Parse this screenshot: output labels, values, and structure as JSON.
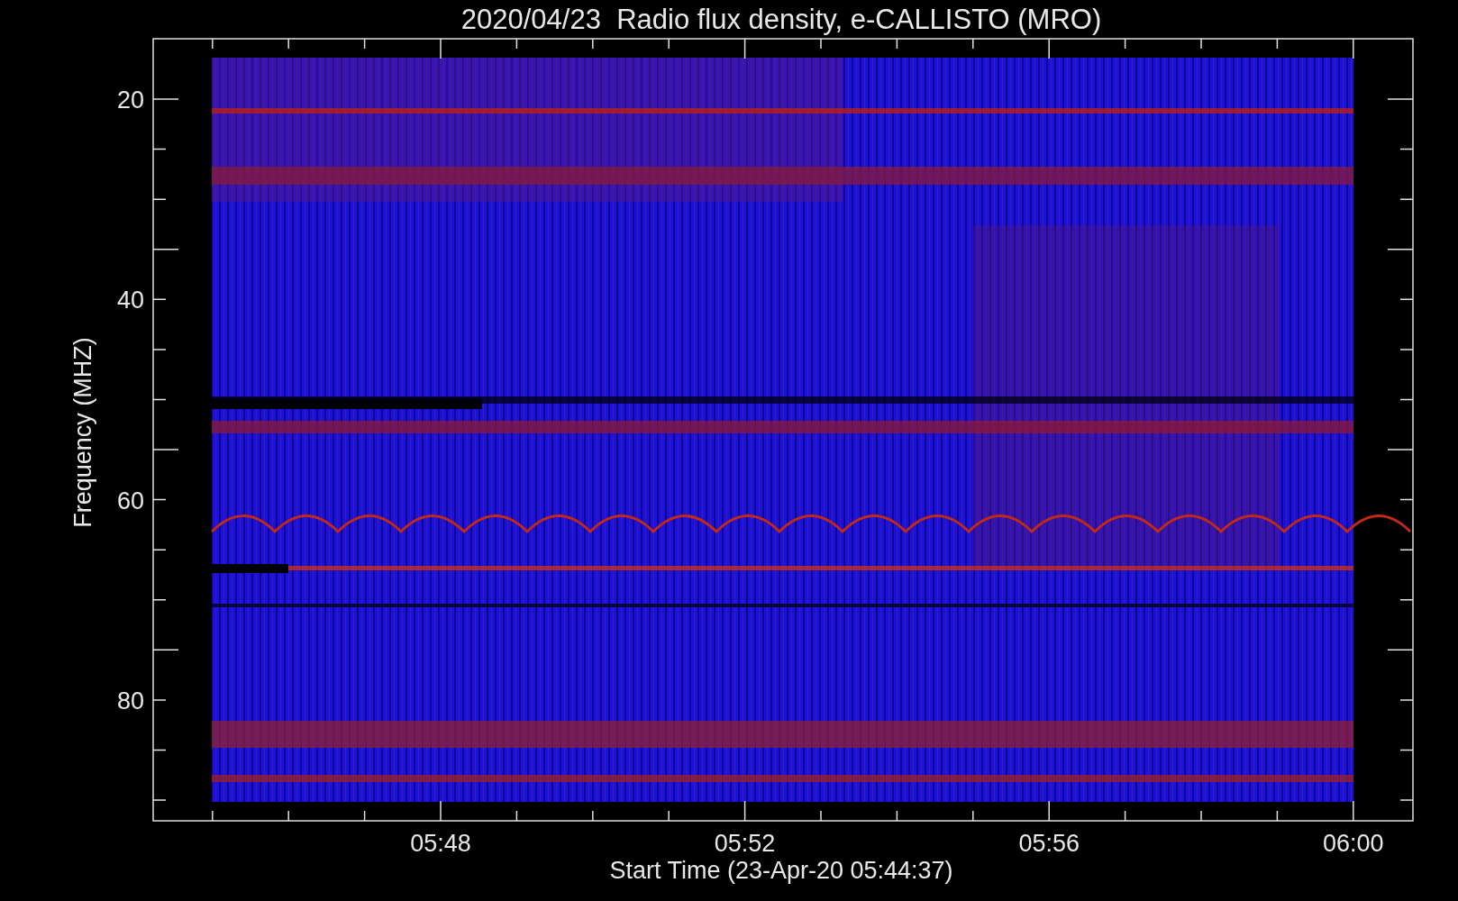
{
  "title": "2020/04/23  Radio flux density, e-CALLISTO (MRO)",
  "y_axis": {
    "label": "Frequency (MHZ)",
    "ticks": [
      "20",
      "40",
      "60",
      "80"
    ]
  },
  "x_axis": {
    "label": "Start Time (23-Apr-20 05:44:37)",
    "ticks": [
      "05:48",
      "05:52",
      "05:56",
      "06:00"
    ]
  }
}
